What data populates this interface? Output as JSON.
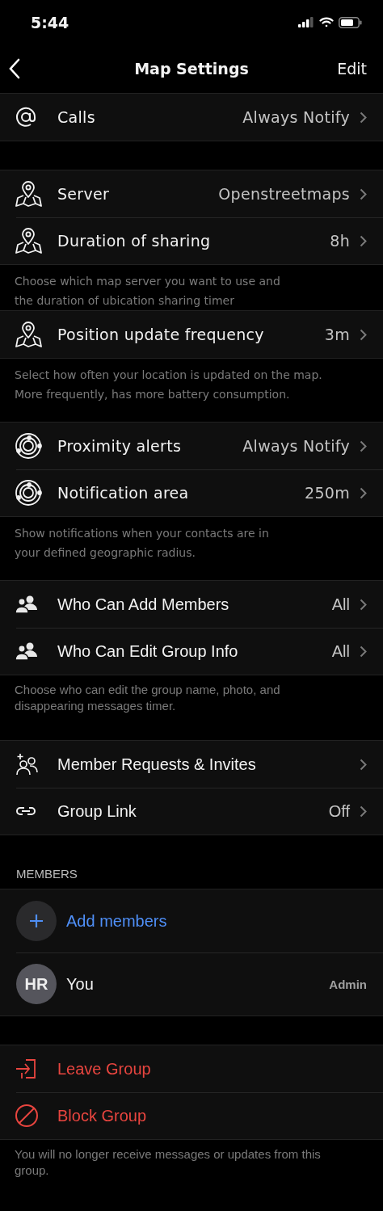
{
  "status_bar": {
    "time": "5:44"
  },
  "nav": {
    "title": "Map Settings",
    "action": "Edit"
  },
  "sections": [
    {
      "kind": "map",
      "rows": [
        {
          "label": "Calls",
          "value": "Always Notify"
        }
      ]
    },
    {
      "kind": "map",
      "rows": [
        {
          "label": "Server",
          "value": "Openstreetmaps"
        },
        {
          "label": "Duration of sharing",
          "value": "8h"
        }
      ],
      "footer": "Choose which map server you want to use and\nthe duration of ubication sharing timer"
    },
    {
      "kind": "map",
      "rows": [
        {
          "label": "Position update frequency",
          "value": "3m"
        }
      ],
      "footer": "Select how often your location is updated on the map.\nMore frequently, has more battery consumption."
    },
    {
      "kind": "map",
      "rows": [
        {
          "label": "Proximity alerts",
          "value": "Always Notify"
        },
        {
          "label": "Notification area",
          "value": "250m"
        }
      ],
      "footer": "Show notifications when your contacts are in\nyour defined geographic radius."
    },
    {
      "kind": "group",
      "rows": [
        {
          "label": "Who Can Add Members",
          "value": "All"
        },
        {
          "label": "Who Can Edit Group Info",
          "value": "All"
        }
      ],
      "footer": "Choose who can edit the group name, photo, and\ndisappearing messages timer."
    },
    {
      "kind": "group",
      "rows": [
        {
          "label": "Member Requests & Invites"
        },
        {
          "label": "Group Link",
          "value": "Off"
        }
      ]
    }
  ],
  "members": {
    "header": "MEMBERS",
    "add_label": "Add members",
    "list": [
      {
        "initials": "HR",
        "name": "You",
        "role": "Admin"
      }
    ]
  },
  "danger": {
    "rows": [
      {
        "label": "Leave Group"
      },
      {
        "label": "Block Group"
      }
    ],
    "footer": "You will no longer receive messages or updates from this\ngroup."
  }
}
